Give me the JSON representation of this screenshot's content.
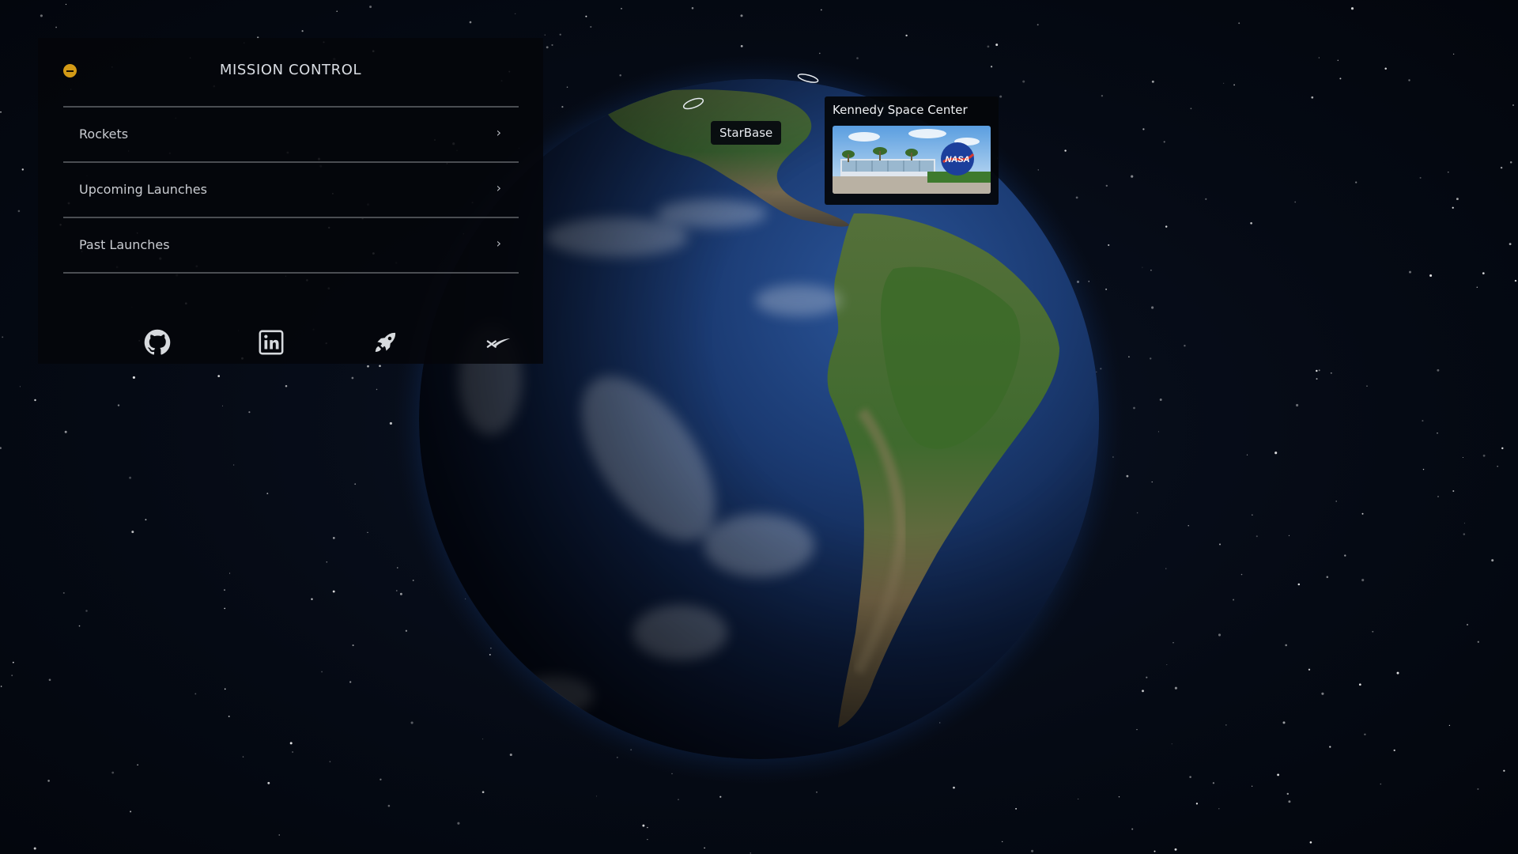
{
  "panel": {
    "title": "MISSION CONTROL",
    "minimize_icon": "minus-circle-icon",
    "accent_color": "#d39a16",
    "menu": [
      {
        "label": "Rockets",
        "icon": "chevron-right-icon",
        "chevron": "›"
      },
      {
        "label": "Upcoming Launches",
        "icon": "chevron-right-icon",
        "chevron": "›"
      },
      {
        "label": "Past Launches",
        "icon": "chevron-right-icon",
        "chevron": "›"
      }
    ],
    "social_links": [
      {
        "icon": "github-icon"
      },
      {
        "icon": "linkedin-icon"
      },
      {
        "icon": "rocket-icon"
      },
      {
        "icon": "spacex-logo-icon"
      }
    ]
  },
  "globe": {
    "locations": [
      {
        "label": "StarBase",
        "icon": "location-ring-icon"
      },
      {
        "label": "Kennedy Space Center",
        "icon": "location-ring-icon",
        "photo": "kennedy-space-center-photo"
      }
    ]
  }
}
